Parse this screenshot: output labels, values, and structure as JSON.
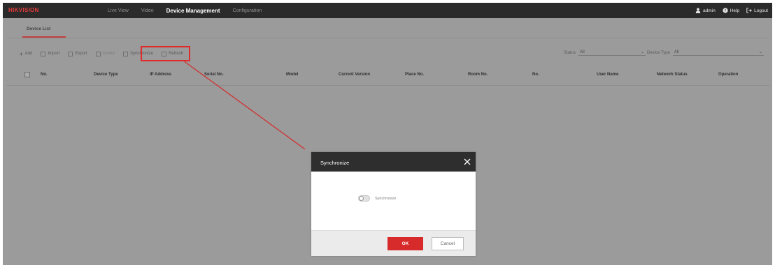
{
  "app": {
    "logo": "HIKVISION",
    "nav": [
      "Live View",
      "Video",
      "Device Management",
      "Configuration"
    ],
    "active_nav": "Device Management",
    "user": "admin",
    "help": "Help",
    "logout": "Logout"
  },
  "subtab": {
    "label": "Device List"
  },
  "toolbar": {
    "add": "Add",
    "import": "Import",
    "export": "Export",
    "delete": "Delete",
    "synchronize": "Synchronize",
    "refresh": "Refresh"
  },
  "filters": {
    "status_label": "Status",
    "status_value": "All",
    "device_type_label": "Device Type",
    "device_type_value": "All"
  },
  "table": {
    "columns": [
      "No.",
      "Device Type",
      "IP Address",
      "Serial No.",
      "Model",
      "Current Version",
      "Place No.",
      "Room No.",
      "No.",
      "User Name",
      "Network Status",
      "Operation"
    ]
  },
  "modal": {
    "title": "Synchronize",
    "toggle_label": "Synchronize",
    "toggle_on": false,
    "ok": "OK",
    "cancel": "Cancel"
  },
  "colors": {
    "accent_red": "#d72a2a",
    "topbar": "#2b2b2b",
    "overlay_gray": "#9b9b9b"
  }
}
